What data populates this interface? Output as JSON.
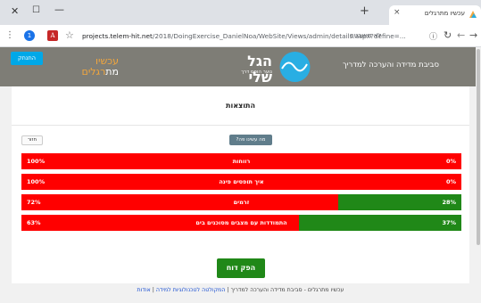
{
  "browser": {
    "window_close": "✕",
    "window_max": "☐",
    "window_min": "—",
    "tab_title": "עכשיו מתרגלים",
    "tab_close": "×",
    "new_tab": "+",
    "profile_letter": "1",
    "url_host": "projects.telem-hit.net",
    "url_path": "/2018/DoingExercise_DanielNoa/WebSite/Views/admin/details.aspx?define=...",
    "secure_label": "לא מאובטח",
    "icons": {
      "menu": "more-vert-icon",
      "star": "star-icon",
      "info": "info-icon",
      "reload": "reload-icon",
      "back": "back-arrow-icon",
      "forward": "forward-arrow-icon"
    }
  },
  "header": {
    "connect_button": "התנתק",
    "brand_line1": "עכשיו",
    "brand_line2_white": "מת",
    "brand_line2_orange": "רגלים",
    "logo_name": "הגל שלי",
    "logo_sub": "נוער הופס דרך",
    "title": "סביבת מדידה והערכה למדריך",
    "colors": {
      "header_bg": "#7e7d76",
      "brand": "#f2a63d",
      "connect_bg": "#00a8e8",
      "logo_wave": "#29aee3"
    }
  },
  "main": {
    "results_title": "התוצאות",
    "back_button": "חזור",
    "what_button": "מה עשינו פה?",
    "rows": [
      {
        "label": "רווחות",
        "left": "100%",
        "right": "0%",
        "green_fraction": 0.0
      },
      {
        "label": "איך תופסים פינה",
        "left": "100%",
        "right": "0%",
        "green_fraction": 0.0
      },
      {
        "label": "זרמים",
        "left": "72%",
        "right": "28%",
        "green_fraction": 0.28
      },
      {
        "label": "התמודדות עם מצבים מסוכנים בים",
        "left": "63%",
        "right": "37%",
        "green_fraction": 0.37
      }
    ],
    "report_button": "הפק דוח",
    "colors": {
      "red": "#ff0000",
      "green": "#208818"
    }
  },
  "footer": {
    "text": "עכשיו מתרגלים - סביבת מדידה והערכה למדריך",
    "separator": " | ",
    "link1": "המקולטה לטכנולוגיות למידה",
    "separator2": " | ",
    "link2": "אודות"
  }
}
